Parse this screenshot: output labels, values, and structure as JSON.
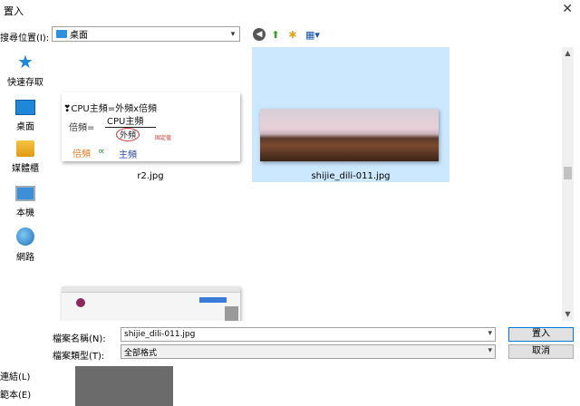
{
  "window": {
    "title": "置入",
    "close_glyph": "✕"
  },
  "toolbar": {
    "lookin_label": "搜尋位置(I):",
    "lookin_value": "桌面",
    "back_glyph": "◀",
    "up_glyph": "⬆",
    "newfolder_glyph": "✱",
    "views_glyph": "▦▾"
  },
  "places": [
    {
      "label": "快速存取",
      "icon": "star-icon"
    },
    {
      "label": "桌面",
      "icon": "desktop-icon"
    },
    {
      "label": "媒體櫃",
      "icon": "library-icon"
    },
    {
      "label": "本機",
      "icon": "computer-icon"
    },
    {
      "label": "網路",
      "icon": "network-icon"
    }
  ],
  "files": [
    {
      "name": "r2.jpg",
      "thumb_text": {
        "line1": "❣CPU主頻=外頻x倍頻",
        "left": "倍頻=",
        "num": "CPU主頻",
        "den": "外頻",
        "note": "固定值",
        "b1": "倍頻",
        "b2": "∝",
        "b3": "主頻"
      }
    },
    {
      "name": "shijie_dili-011.jpg",
      "selected": true
    },
    {
      "name": ""
    }
  ],
  "footer": {
    "filename_label": "檔案名稱(N):",
    "filename_value": "shijie_dili-011.jpg",
    "filetype_label": "檔案類型(T):",
    "filetype_value": "全部格式",
    "place_button": "置入",
    "cancel_button": "取消",
    "link_label": "連結(L)",
    "template_label": "範本(E)"
  },
  "colors": {
    "accent": "#0078d7",
    "selection": "#cce8ff",
    "preview": "#6b6b6b"
  }
}
